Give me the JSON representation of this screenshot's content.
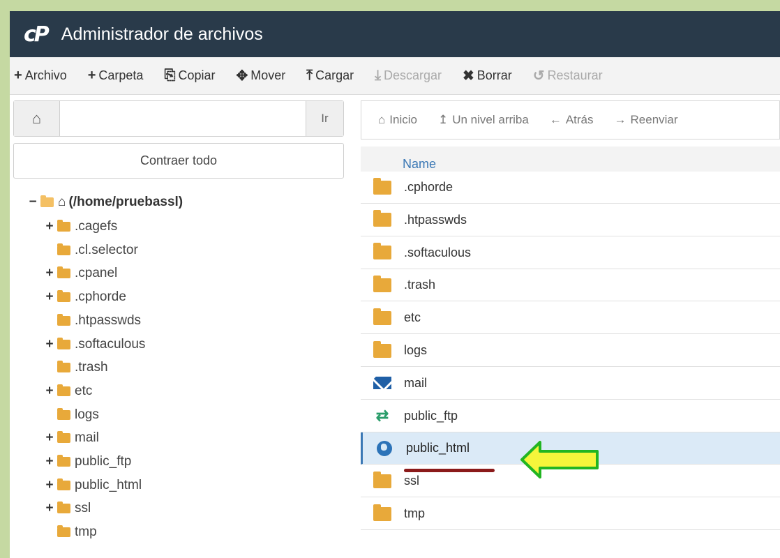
{
  "header": {
    "logo": "cP",
    "title": "Administrador de archivos"
  },
  "toolbar": {
    "items": [
      {
        "icon": "+",
        "label": "Archivo",
        "enabled": true
      },
      {
        "icon": "+",
        "label": "Carpeta",
        "enabled": true
      },
      {
        "icon": "⎘",
        "label": "Copiar",
        "enabled": true
      },
      {
        "icon": "✥",
        "label": "Mover",
        "enabled": true
      },
      {
        "icon": "⤒",
        "label": "Cargar",
        "enabled": true
      },
      {
        "icon": "⤓",
        "label": "Descargar",
        "enabled": false
      },
      {
        "icon": "✖",
        "label": "Borrar",
        "enabled": true
      },
      {
        "icon": "↺",
        "label": "Restaurar",
        "enabled": false
      }
    ]
  },
  "left": {
    "path_value": "",
    "go_label": "Ir",
    "collapse_label": "Contraer todo",
    "root_label": "(/home/pruebassl)",
    "tree": [
      {
        "label": ".cagefs",
        "expandable": true
      },
      {
        "label": ".cl.selector",
        "expandable": false
      },
      {
        "label": ".cpanel",
        "expandable": true
      },
      {
        "label": ".cphorde",
        "expandable": true
      },
      {
        "label": ".htpasswds",
        "expandable": false
      },
      {
        "label": ".softaculous",
        "expandable": true
      },
      {
        "label": ".trash",
        "expandable": false
      },
      {
        "label": "etc",
        "expandable": true
      },
      {
        "label": "logs",
        "expandable": false
      },
      {
        "label": "mail",
        "expandable": true
      },
      {
        "label": "public_ftp",
        "expandable": true
      },
      {
        "label": "public_html",
        "expandable": true
      },
      {
        "label": "ssl",
        "expandable": true
      },
      {
        "label": "tmp",
        "expandable": false
      }
    ]
  },
  "right": {
    "nav": [
      {
        "icon": "home-icon",
        "label": "Inicio"
      },
      {
        "icon": "level-up-icon",
        "label": "Un nivel arriba"
      },
      {
        "icon": "arrow-left-icon",
        "label": "Atrás"
      },
      {
        "icon": "arrow-right-icon",
        "label": "Reenviar"
      }
    ],
    "column_name": "Name",
    "rows": [
      {
        "name": ".cphorde",
        "icon": "folder"
      },
      {
        "name": ".htpasswds",
        "icon": "folder"
      },
      {
        "name": ".softaculous",
        "icon": "folder"
      },
      {
        "name": ".trash",
        "icon": "folder"
      },
      {
        "name": "etc",
        "icon": "folder"
      },
      {
        "name": "logs",
        "icon": "folder"
      },
      {
        "name": "mail",
        "icon": "mail"
      },
      {
        "name": "public_ftp",
        "icon": "ftp"
      },
      {
        "name": "public_html",
        "icon": "globe",
        "selected": true
      },
      {
        "name": "ssl",
        "icon": "folder"
      },
      {
        "name": "tmp",
        "icon": "folder"
      }
    ]
  },
  "colors": {
    "header_bg": "#293a4a",
    "page_border": "#c5d9a2",
    "folder": "#e8a93a",
    "selected_row": "#dbeaf7",
    "annotation_arrow_fill": "#f5f53b",
    "annotation_arrow_stroke": "#22b522",
    "annotation_underline": "#8b1a1a"
  }
}
